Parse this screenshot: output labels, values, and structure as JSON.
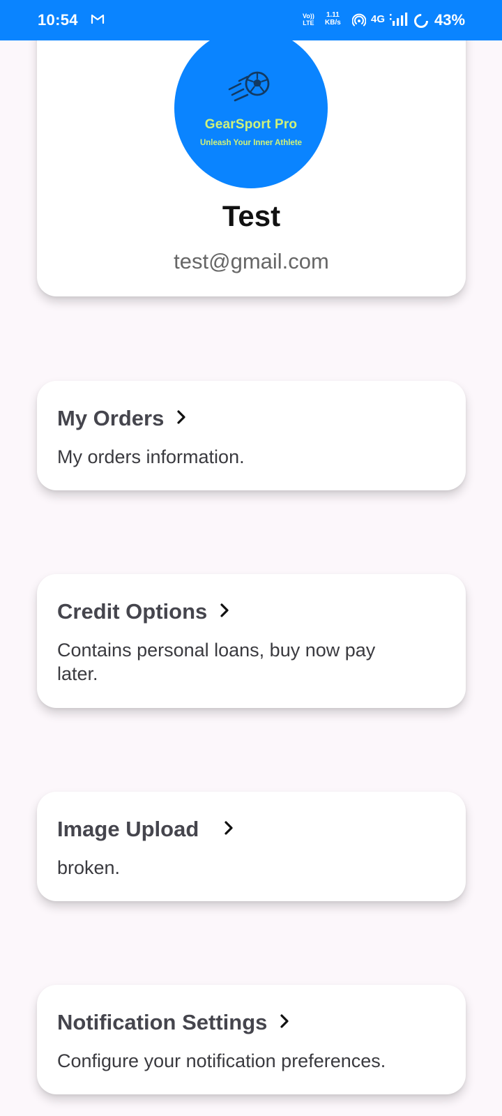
{
  "status_bar": {
    "time": "10:54",
    "volte": "Vo)) LTE",
    "volte_top": "Vo))",
    "volte_bottom": "LTE",
    "speed_value": "1.11",
    "speed_unit": "KB/s",
    "network": "4G",
    "battery": "43%",
    "icons": [
      "gmail-icon",
      "hotspot-icon",
      "signal-icon",
      "battery-saver-icon"
    ],
    "background_color": "#0A84FF"
  },
  "profile": {
    "logo": {
      "brand": "GearSport Pro",
      "tagline": "Unleash Your Inner Athlete",
      "icon": "soccer-ball-icon",
      "background_color": "#0A84FF",
      "text_color": "#CFF27A"
    },
    "name": "Test",
    "email": "test@gmail.com"
  },
  "menu": [
    {
      "title": "My Orders",
      "description": "My orders information.",
      "icon": "chevron-right-icon"
    },
    {
      "title": "Credit Options",
      "description": "Contains personal loans, buy now pay later.",
      "icon": "chevron-right-icon"
    },
    {
      "title": "Image Upload",
      "description": "broken.",
      "icon": "chevron-right-icon"
    },
    {
      "title": "Notification Settings",
      "description": "Configure your notification preferences.",
      "icon": "chevron-right-icon"
    }
  ],
  "colors": {
    "page_background": "#FCF7FB",
    "card_background": "#FFFFFF",
    "title_text": "#45454D"
  }
}
